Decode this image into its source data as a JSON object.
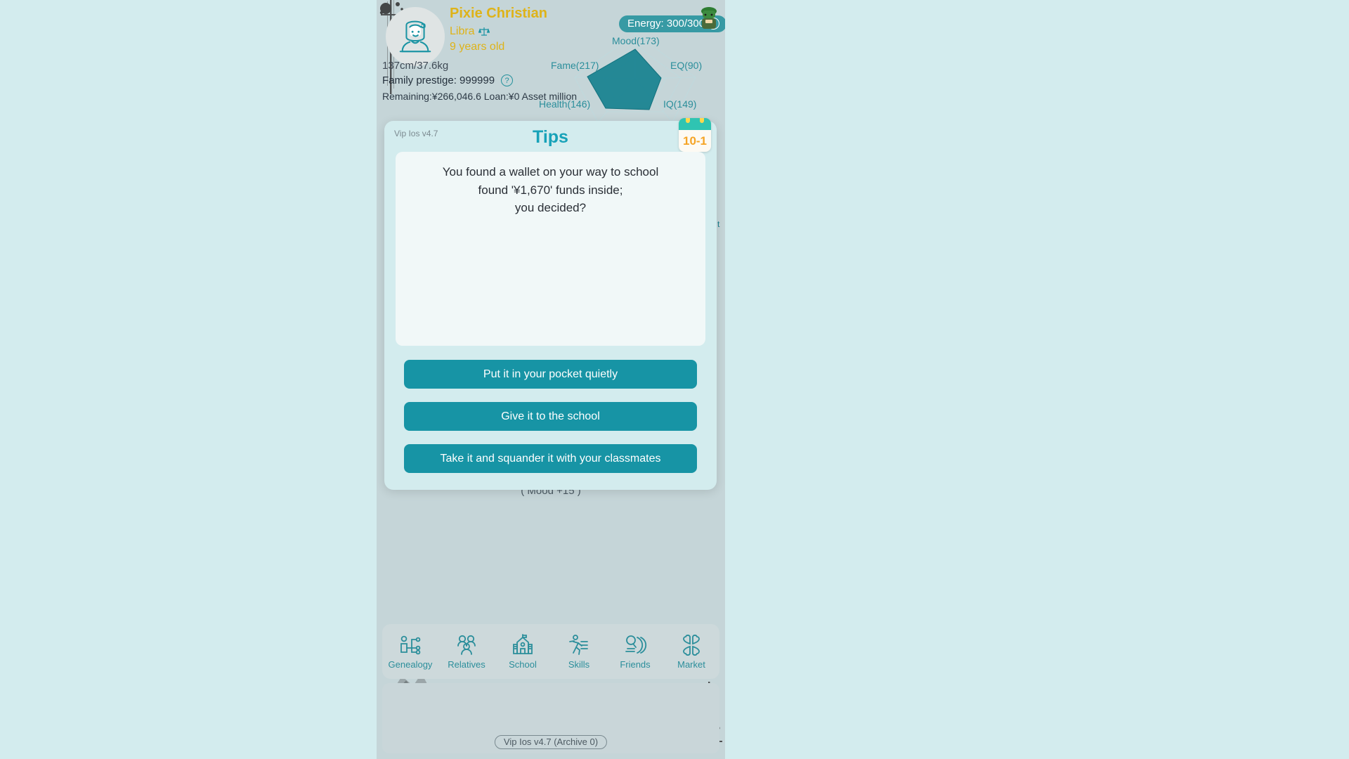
{
  "app": {
    "version_tag": "Vip Ios v4.7",
    "archive_label": "Vip Ios v4.7  (Archive 0)"
  },
  "profile": {
    "name": "Pixie Christian",
    "zodiac": "Libra",
    "zodiac_icon": "scales-icon",
    "age": "9 years old",
    "body": "137cm/37.6kg",
    "prestige": "Family prestige: 999999",
    "help_icon": "question-mark-icon",
    "avatar_icon": "girl-avatar-icon",
    "obscured_line": "Remaining:¥266,046.6 Loan:¥0 Asset million",
    "energy": "Energy: 300/300",
    "energy_plus_icon": "plus-icon"
  },
  "chart_data": {
    "type": "radar",
    "title": "",
    "categories": [
      "Mood",
      "EQ",
      "IQ",
      "Health",
      "Fame"
    ],
    "labels": [
      "Mood(173)",
      "EQ(90)",
      "IQ(149)",
      "Health(146)",
      "Fame(217)"
    ],
    "values": [
      173,
      90,
      149,
      146,
      217
    ],
    "max": 260,
    "grid": true,
    "legend": "none"
  },
  "dialog": {
    "title": "Tips",
    "calendar_date": "10-1",
    "calendar_icon": "calendar-icon",
    "message_lines": [
      "You found a wallet on your way to school",
      "found '¥1,670' funds inside;",
      "you decided?"
    ],
    "choices": [
      "Put it in your pocket quietly",
      "Give it to the school",
      "Take it and squander it with your classmates"
    ]
  },
  "background": {
    "status_line": "(  Mood +15  )",
    "right_sliver": "t"
  },
  "nav": {
    "items": [
      {
        "label": "Genealogy",
        "icon": "genealogy-icon"
      },
      {
        "label": "Relatives",
        "icon": "relatives-icon"
      },
      {
        "label": "School",
        "icon": "school-icon"
      },
      {
        "label": "Skills",
        "icon": "skills-icon"
      },
      {
        "label": "Friends",
        "icon": "friends-icon"
      },
      {
        "label": "Market",
        "icon": "market-icon"
      }
    ]
  },
  "colors": {
    "accent": "#17a2b8",
    "button": "#1794a5",
    "name": "#deb319",
    "dialog_bg": "#d3ecee",
    "phone_bg": "#c5d5d8",
    "page_bg": "#d3ecee"
  }
}
